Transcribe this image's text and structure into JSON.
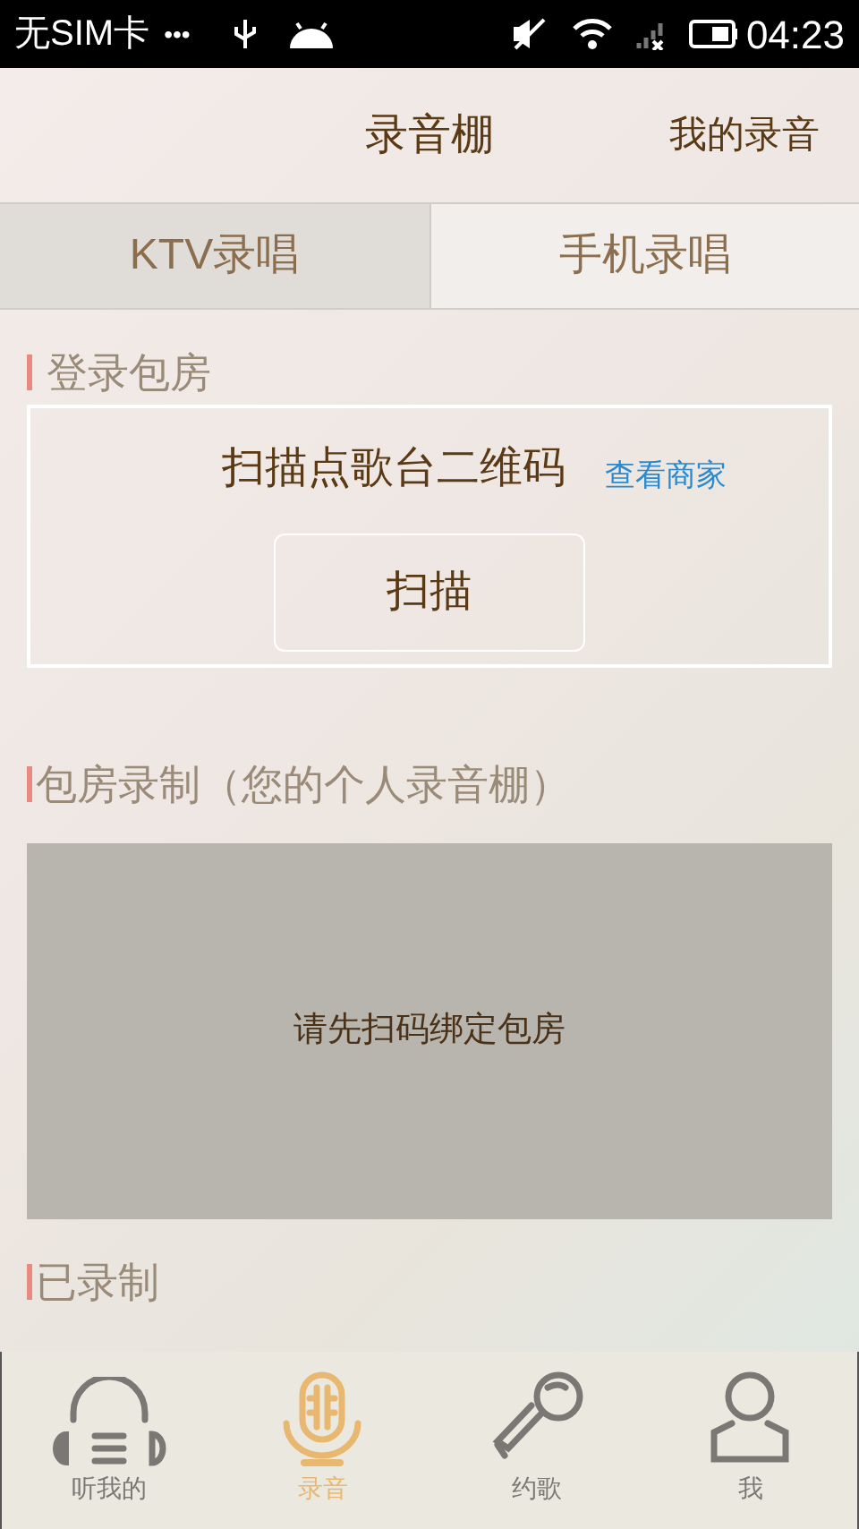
{
  "status_bar": {
    "carrier": "无SIM卡",
    "dots": "•••",
    "time": "04:23"
  },
  "header": {
    "title": "录音棚",
    "action": "我的录音"
  },
  "tabs": [
    {
      "label": "KTV录唱",
      "selected": true
    },
    {
      "label": "手机录唱",
      "selected": false
    }
  ],
  "login_section": {
    "title": "登录包房",
    "prompt": "扫描点歌台二维码",
    "link": "查看商家",
    "button": "扫描"
  },
  "room_section": {
    "title": "包房录制（您的个人录音棚）",
    "empty_message": "请先扫码绑定包房"
  },
  "recorded_section": {
    "title": "已录制"
  },
  "bottom_nav": [
    {
      "label": "听我的",
      "kind": "headphones",
      "selected": false
    },
    {
      "label": "录音",
      "kind": "mic",
      "selected": true
    },
    {
      "label": "约歌",
      "kind": "karaoke",
      "selected": false
    },
    {
      "label": "我",
      "kind": "person",
      "selected": false
    }
  ]
}
